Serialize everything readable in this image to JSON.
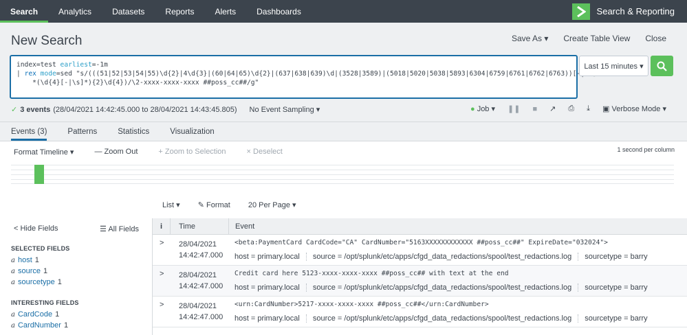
{
  "nav": {
    "items": [
      "Search",
      "Analytics",
      "Datasets",
      "Reports",
      "Alerts",
      "Dashboards"
    ],
    "app_name": "Search & Reporting"
  },
  "header": {
    "title": "New Search",
    "save_as": "Save As ▾",
    "create_table_view": "Create Table View",
    "close": "Close"
  },
  "search": {
    "line1_a": "index=test ",
    "line1_b": "earliest",
    "line1_c": "=-1m",
    "line2_pipe": "| ",
    "line2_cmd": "rex",
    "line2_mode_k": " mode",
    "line2_rest": "=sed \"s/(((51|52|53|54|55)\\d{2}|4\\d{3}|(60|64|65)\\d{2}|(637|638|639)\\d|(3528|3589)|(5018|5020|5038|5893|6304|6759|6761|6762|6763))[-|\\s]",
    "line3": "    *(\\d{4}[-|\\s]*){2}\\d{4})/\\2-xxxx-xxxx-xxxx ##poss_cc##/g\"",
    "time_range": "Last 15 minutes ▾"
  },
  "status": {
    "events": "3 events",
    "range": "(28/04/2021 14:42:45.000 to 28/04/2021 14:43:45.805)",
    "sampling": "No Event Sampling ▾",
    "job": "Job ▾",
    "mode": "Verbose Mode ▾"
  },
  "tabs": [
    "Events (3)",
    "Patterns",
    "Statistics",
    "Visualization"
  ],
  "timeline": {
    "format": "Format Timeline ▾",
    "zoom_out": "— Zoom Out",
    "zoom_sel": "+ Zoom to Selection",
    "deselect": "× Deselect",
    "scale": "1 second per column"
  },
  "results_toolbar": {
    "list": "List ▾",
    "format": "Format",
    "per_page": "20 Per Page ▾"
  },
  "sidebar": {
    "hide_fields": "< Hide Fields",
    "all_fields": "All Fields",
    "selected_title": "SELECTED FIELDS",
    "selected": [
      {
        "name": "host",
        "count": "1"
      },
      {
        "name": "source",
        "count": "1"
      },
      {
        "name": "sourcetype",
        "count": "1"
      }
    ],
    "interesting_title": "INTERESTING FIELDS",
    "interesting": [
      {
        "name": "CardCode",
        "count": "1"
      },
      {
        "name": "CardNumber",
        "count": "1"
      }
    ]
  },
  "table": {
    "col_i": "i",
    "col_time": "Time",
    "col_event": "Event",
    "rows": [
      {
        "date": "28/04/2021",
        "time": "14:42:47.000",
        "event": "<beta:PaymentCard CardCode=\"CA\" CardNumber=\"5163XXXXXXXXXXXX ##poss_cc##\" ExpireDate=\"032024\">",
        "host": "host = primary.local",
        "source": "source = /opt/splunk/etc/apps/cfgd_data_redactions/spool/test_redactions.log",
        "sourcetype": "sourcetype = barry"
      },
      {
        "date": "28/04/2021",
        "time": "14:42:47.000",
        "event": "Credit card here 5123-xxxx-xxxx-xxxx ##poss_cc## with text at the end",
        "host": "host = primary.local",
        "source": "source = /opt/splunk/etc/apps/cfgd_data_redactions/spool/test_redactions.log",
        "sourcetype": "sourcetype = barry"
      },
      {
        "date": "28/04/2021",
        "time": "14:42:47.000",
        "event": "<urn:CardNumber>5217-xxxx-xxxx-xxxx ##poss_cc##</urn:CardNumber>",
        "host": "host = primary.local",
        "source": "source = /opt/splunk/etc/apps/cfgd_data_redactions/spool/test_redactions.log",
        "sourcetype": "sourcetype = barry"
      }
    ]
  }
}
